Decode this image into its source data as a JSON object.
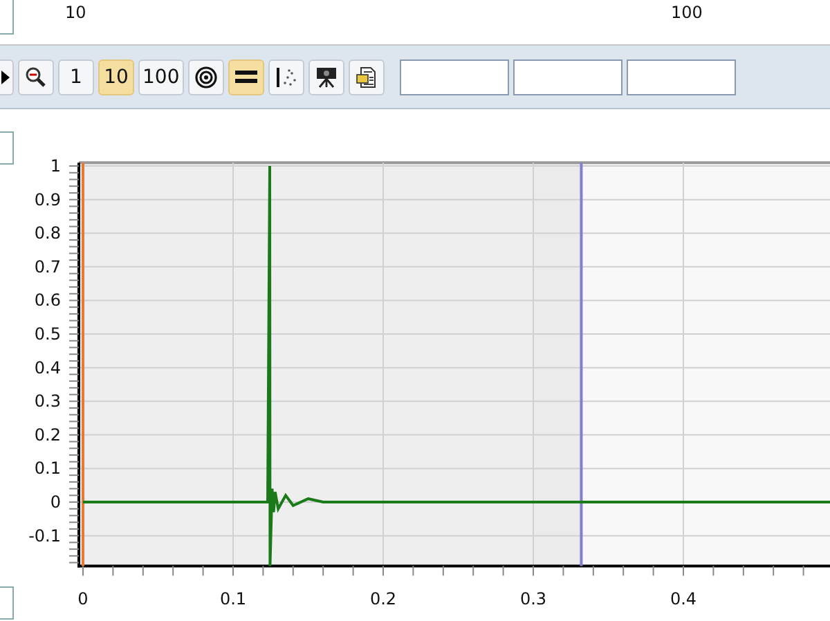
{
  "scale_labels": [
    "10",
    "100"
  ],
  "toolbar": {
    "buttons": [
      {
        "kind": "play",
        "selected": false
      },
      {
        "kind": "zoom-out",
        "selected": false
      },
      {
        "kind": "text",
        "label": "1",
        "selected": false
      },
      {
        "kind": "text",
        "label": "10",
        "selected": true
      },
      {
        "kind": "text",
        "label": "100",
        "selected": false
      },
      {
        "kind": "target",
        "selected": false
      },
      {
        "kind": "equals",
        "selected": true
      },
      {
        "kind": "scatter",
        "selected": false
      },
      {
        "kind": "projector",
        "selected": false
      },
      {
        "kind": "document",
        "selected": false
      }
    ],
    "fields": [
      {
        "kind": "text"
      },
      {
        "kind": "text"
      },
      {
        "kind": "text"
      }
    ]
  },
  "chart": {
    "chart_data": {
      "type": "line",
      "x": [
        0,
        0.1,
        0.12,
        0.123,
        0.1244,
        0.1246,
        0.126,
        0.127,
        0.128,
        0.13,
        0.135,
        0.14,
        0.15,
        0.16,
        0.2,
        0.25,
        0.5
      ],
      "series": [
        {
          "color": "#1a7a1a",
          "values": [
            0,
            0,
            0,
            0,
            1,
            -0.19,
            0.04,
            -0.03,
            0.03,
            -0.02,
            0.02,
            -0.01,
            0.01,
            0,
            0,
            0,
            0
          ]
        }
      ],
      "xticks": [
        0,
        0.1,
        0.2,
        0.3,
        0.4
      ],
      "yticks": [
        -0.1,
        0,
        0.1,
        0.2,
        0.3,
        0.4,
        0.5,
        0.6,
        0.7,
        0.8,
        0.9,
        1
      ],
      "xlim": [
        0,
        0.5
      ],
      "ylim": [
        -0.19,
        1.01
      ],
      "grid": true,
      "bands": [
        {
          "axis": "x",
          "from": 0,
          "to": 0.3,
          "color": "#eeeeee"
        },
        {
          "axis": "x",
          "from": 0.3,
          "to": 0.332,
          "color": "#ebebeb"
        },
        {
          "axis": "x",
          "from": 0.332,
          "to": 0.5,
          "color": "#f8f8f8"
        }
      ],
      "ref_lines": [
        {
          "axis": "x",
          "value": 0,
          "color": "#e07b39"
        },
        {
          "axis": "x",
          "value": 0.332,
          "color": "#8080cc"
        }
      ]
    }
  }
}
